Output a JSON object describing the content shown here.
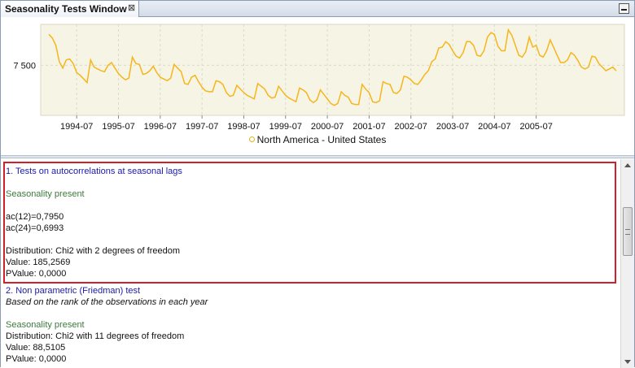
{
  "window": {
    "title": "Seasonality Tests Window",
    "close_glyph": "⊠"
  },
  "chart_data": {
    "type": "line",
    "x_tick_labels": [
      "1994-07",
      "1995-07",
      "1996-07",
      "1997-07",
      "1998-07",
      "1999-07",
      "2000-07",
      "2001-07",
      "2002-07",
      "2003-07",
      "2004-07",
      "2005-07"
    ],
    "y_tick_labels": [
      "7 500"
    ],
    "x_start": "1993-11",
    "frequency": "monthly",
    "series": [
      {
        "name": "North America - United States",
        "color": "#f5b61c",
        "values": [
          7840,
          7800,
          7720,
          7540,
          7470,
          7560,
          7570,
          7520,
          7420,
          7390,
          7350,
          7310,
          7560,
          7480,
          7460,
          7440,
          7430,
          7500,
          7530,
          7470,
          7410,
          7370,
          7340,
          7360,
          7590,
          7520,
          7510,
          7400,
          7410,
          7440,
          7490,
          7420,
          7370,
          7350,
          7330,
          7360,
          7510,
          7470,
          7430,
          7300,
          7290,
          7370,
          7390,
          7320,
          7260,
          7220,
          7210,
          7210,
          7330,
          7320,
          7290,
          7200,
          7160,
          7170,
          7280,
          7240,
          7200,
          7170,
          7150,
          7130,
          7300,
          7270,
          7240,
          7170,
          7140,
          7150,
          7270,
          7220,
          7170,
          7140,
          7120,
          7100,
          7250,
          7230,
          7200,
          7120,
          7090,
          7120,
          7230,
          7180,
          7130,
          7080,
          7060,
          7080,
          7210,
          7170,
          7150,
          7080,
          7070,
          7070,
          7290,
          7240,
          7200,
          7100,
          7090,
          7110,
          7320,
          7300,
          7290,
          7200,
          7190,
          7230,
          7380,
          7370,
          7340,
          7300,
          7290,
          7340,
          7400,
          7440,
          7540,
          7570,
          7690,
          7700,
          7760,
          7730,
          7660,
          7600,
          7580,
          7640,
          7760,
          7760,
          7720,
          7610,
          7600,
          7660,
          7810,
          7860,
          7840,
          7710,
          7660,
          7660,
          7890,
          7830,
          7720,
          7610,
          7590,
          7650,
          7810,
          7700,
          7720,
          7610,
          7590,
          7660,
          7780,
          7700,
          7610,
          7530,
          7530,
          7560,
          7640,
          7610,
          7550,
          7480,
          7460,
          7480,
          7600,
          7590,
          7520,
          7480,
          7440,
          7460,
          7480,
          7440
        ]
      }
    ]
  },
  "results": {
    "test1_title": "1. Tests on autocorrelations at seasonal lags",
    "test1_verdict": "Seasonality present",
    "test1_ac12": "ac(12)=0,7950",
    "test1_ac24": "ac(24)=0,6993",
    "test1_distribution": "Distribution: Chi2 with 2 degrees of freedom",
    "test1_value": "Value: 185,2569",
    "test1_pvalue": "PValue: 0,0000",
    "test2_title": "2. Non parametric (Friedman) test",
    "test2_subtitle": "Based on the rank of the observations in each year",
    "test2_verdict": "Seasonality present",
    "test2_distribution": "Distribution: Chi2 with 11 degrees of freedom",
    "test2_value": "Value: 88,5105",
    "test2_pvalue": "PValue: 0,0000"
  }
}
